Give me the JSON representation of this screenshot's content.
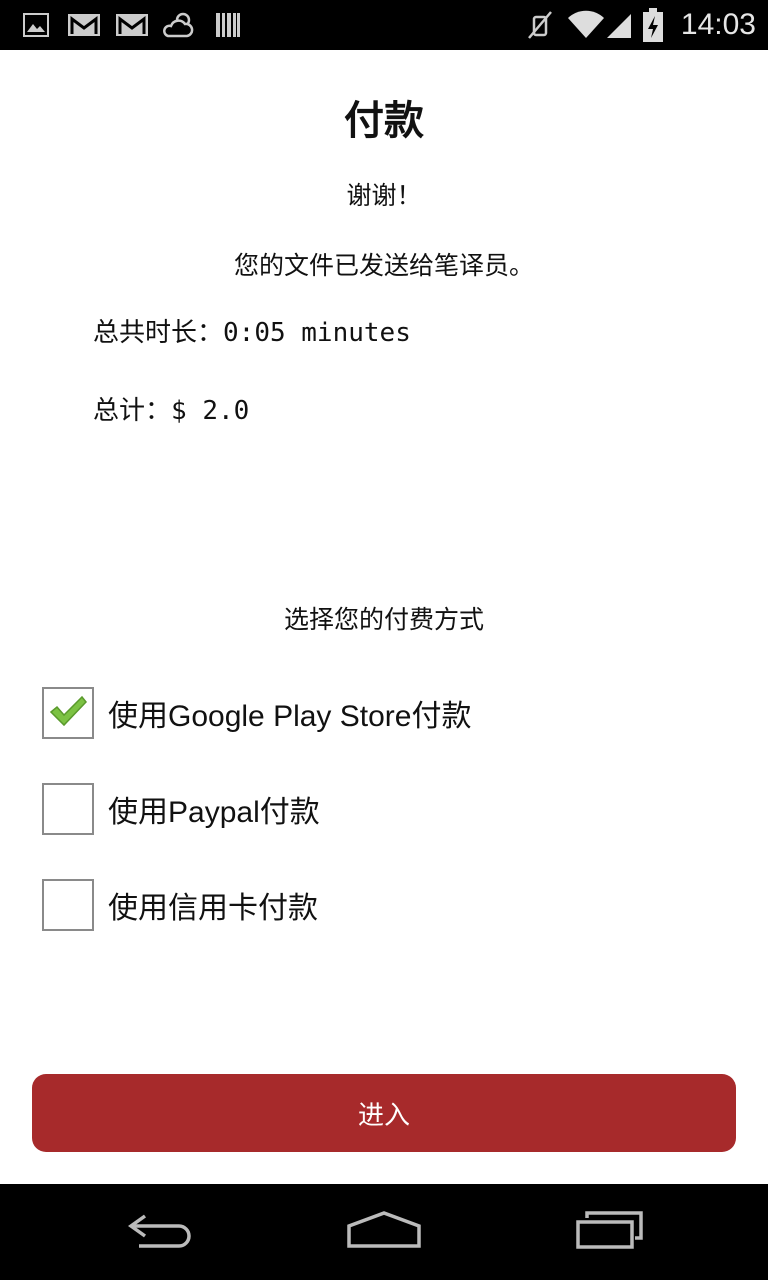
{
  "status_bar": {
    "time": "14:03",
    "icons": [
      "gallery-icon",
      "gmail-icon",
      "gmail-icon",
      "weather-icon",
      "barcode-icon",
      "mute-icon",
      "wifi-icon",
      "signal-icon",
      "battery-charging-icon"
    ]
  },
  "page": {
    "title": "付款",
    "thanks": "谢谢！",
    "sent_message": "您的文件已发送给笔译员。",
    "duration_label": "总共时长：",
    "duration_value": "0:05 minutes",
    "total_label": "总计：",
    "total_value": "$ 2.0"
  },
  "payment": {
    "prompt": "选择您的付费方式",
    "options": [
      {
        "label": "使用Google Play Store付款",
        "checked": true
      },
      {
        "label": "使用Paypal付款",
        "checked": false
      },
      {
        "label": "使用信用卡付款",
        "checked": false
      }
    ]
  },
  "actions": {
    "enter_label": "进入"
  },
  "colors": {
    "accent": "#a72a2b",
    "check": "#7cc243"
  }
}
